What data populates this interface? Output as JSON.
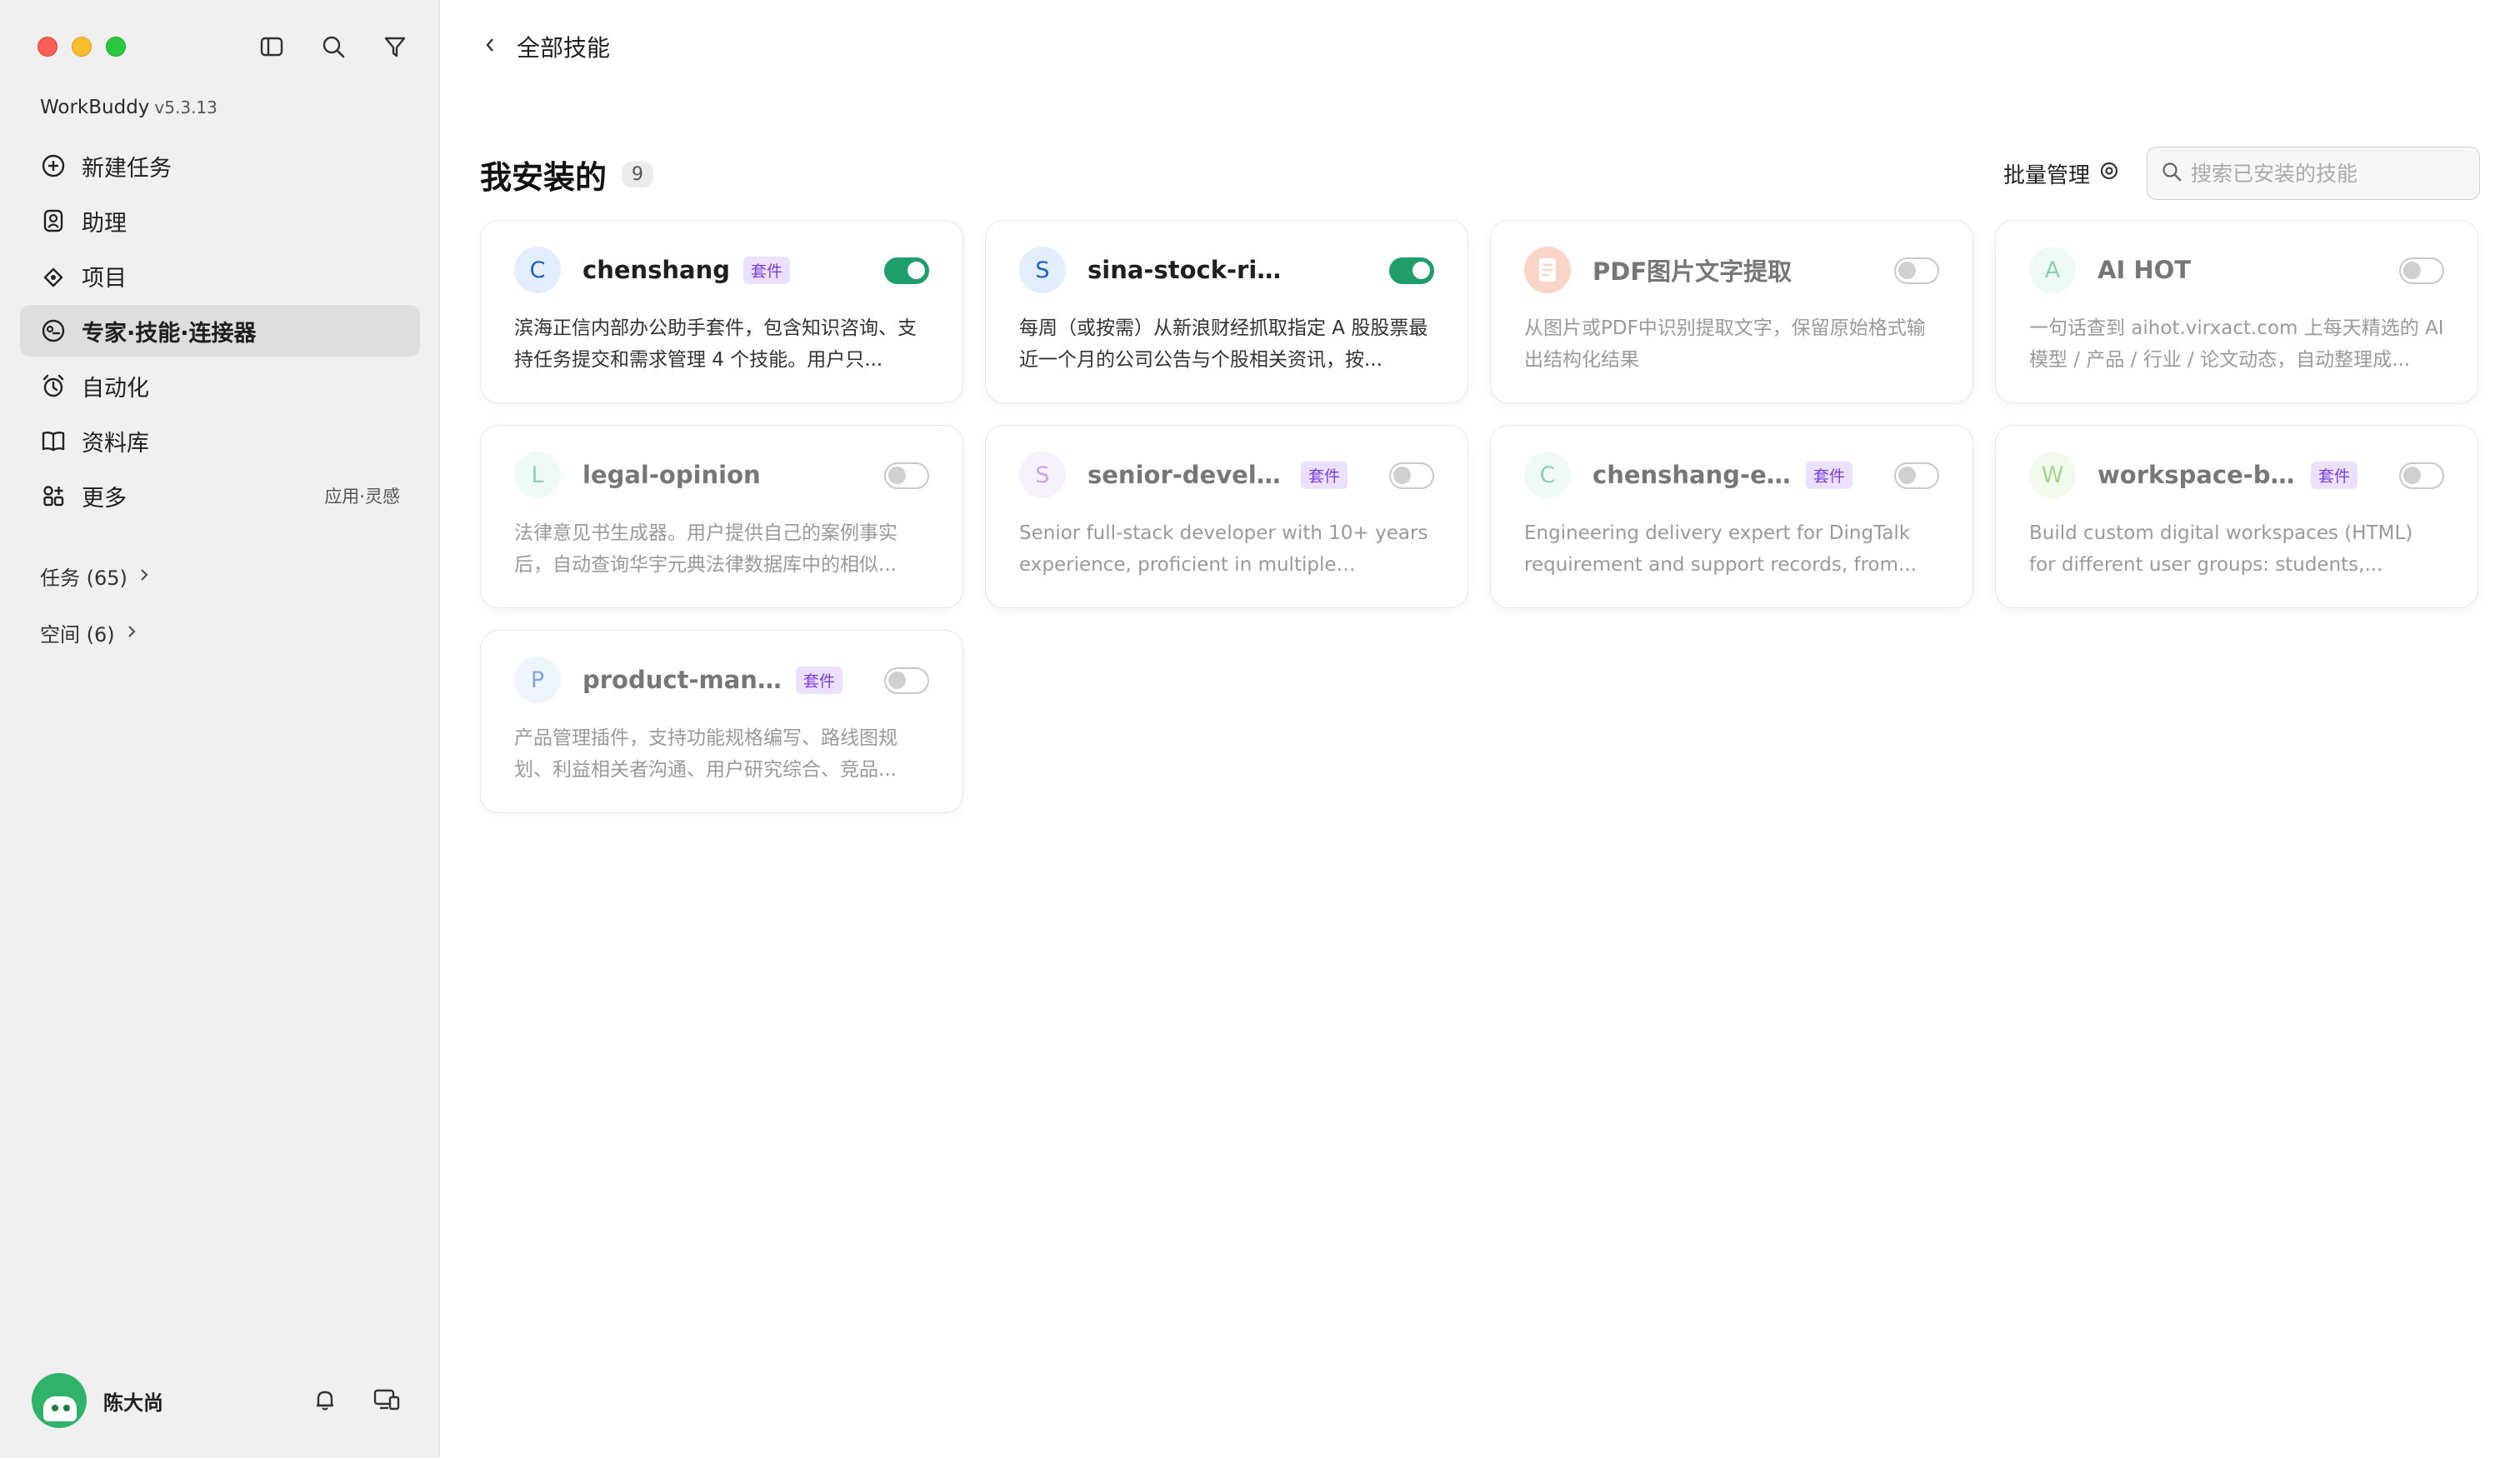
{
  "app": {
    "name": "WorkBuddy",
    "version": "v5.3.13"
  },
  "sidebar": {
    "items": [
      {
        "label": "新建任务",
        "icon": "plus-circle-icon"
      },
      {
        "label": "助理",
        "icon": "assistant-icon"
      },
      {
        "label": "项目",
        "icon": "project-icon"
      },
      {
        "label": "专家·技能·连接器",
        "icon": "experts-icon",
        "active": true
      },
      {
        "label": "自动化",
        "icon": "alarm-clock-icon"
      },
      {
        "label": "资料库",
        "icon": "book-icon"
      },
      {
        "label": "更多",
        "icon": "apps-icon",
        "extra": "应用·灵感"
      }
    ],
    "groups": [
      {
        "label": "任务 (65)"
      },
      {
        "label": "空间 (6)"
      }
    ],
    "user": {
      "name": "陈大尚"
    }
  },
  "header": {
    "back_label": "全部技能"
  },
  "section": {
    "title": "我安装的",
    "count": "9",
    "batch_label": "批量管理",
    "search_placeholder": "搜索已安装的技能"
  },
  "cards": [
    {
      "letter": "C",
      "name": "chenshang",
      "badge": "套件",
      "enabled": true,
      "avatar_bg": "#e3eefc",
      "avatar_fg": "#1f5fbf",
      "desc": "滨海正信内部办公助手套件，包含知识咨询、支持任务提交和需求管理 4 个技能。用户只..."
    },
    {
      "letter": "S",
      "name": "sina-stock-risk-rep...",
      "badge": "",
      "enabled": true,
      "avatar_bg": "#e3eefc",
      "avatar_fg": "#1f5fbf",
      "desc": "每周（或按需）从新浪财经抓取指定 A 股股票最近一个月的公司公告与个股相关资讯，按..."
    },
    {
      "letter": "",
      "name": "PDF图片文字提取",
      "badge": "",
      "enabled": false,
      "avatar_bg": "#f6b39a",
      "avatar_fg": "#ffffff",
      "icon": "document-icon",
      "desc": "从图片或PDF中识别提取文字，保留原始格式输出结构化结果"
    },
    {
      "letter": "A",
      "name": "AI HOT",
      "badge": "",
      "enabled": false,
      "avatar_bg": "#e2f7ef",
      "avatar_fg": "#2aa876",
      "desc": "一句话查到 aihot.virxact.com 上每天精选的 AI 模型 / 产品 / 行业 / 论文动态，自动整理成..."
    },
    {
      "letter": "L",
      "name": "legal-opinion",
      "badge": "",
      "enabled": false,
      "avatar_bg": "#e2f7ef",
      "avatar_fg": "#2aa876",
      "desc": "法律意见书生成器。用户提供自己的案例事实后，自动查询华宇元典法律数据库中的相似..."
    },
    {
      "letter": "S",
      "name": "senior-develo...",
      "badge": "套件",
      "enabled": false,
      "avatar_bg": "#f1e6fb",
      "avatar_fg": "#9b5bd6",
      "desc": "Senior full-stack developer with 10+ years experience, proficient in multiple languag..."
    },
    {
      "letter": "C",
      "name": "chenshang-en...",
      "badge": "套件",
      "enabled": false,
      "avatar_bg": "#e2f7ef",
      "avatar_fg": "#2aa876",
      "desc": "Engineering delivery expert for DingTalk requirement and support records, from..."
    },
    {
      "letter": "W",
      "name": "workspace-bu...",
      "badge": "套件",
      "enabled": false,
      "avatar_bg": "#e9f7df",
      "avatar_fg": "#5fb32a",
      "desc": "Build custom digital workspaces (HTML) for different user groups: students,..."
    },
    {
      "letter": "P",
      "name": "product-mana...",
      "badge": "套件",
      "enabled": false,
      "avatar_bg": "#e3eefc",
      "avatar_fg": "#1f5fbf",
      "desc": "产品管理插件，支持功能规格编写、路线图规划、利益相关者沟通、用户研究综合、竞品..."
    }
  ]
}
